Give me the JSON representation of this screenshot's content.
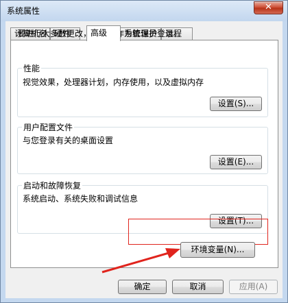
{
  "window": {
    "title": "系统属性",
    "close_label": "✕"
  },
  "tabs": [
    {
      "label": "计算机名",
      "active": false
    },
    {
      "label": "硬件",
      "active": false
    },
    {
      "label": "高级",
      "active": true
    },
    {
      "label": "系统保护",
      "active": false
    },
    {
      "label": "远程",
      "active": false
    }
  ],
  "notice": "要进行大多数更改，您必须作为管理员登录。",
  "groups": {
    "performance": {
      "title": "性能",
      "desc": "视觉效果，处理器计划，内存使用，以及虚拟内存",
      "button": "设置(S)..."
    },
    "profiles": {
      "title": "用户配置文件",
      "desc": "与您登录有关的桌面设置",
      "button": "设置(E)..."
    },
    "startup": {
      "title": "启动和故障恢复",
      "desc": "系统启动、系统失败和调试信息",
      "button": "设置(T)..."
    }
  },
  "env_button": "环境变量(N)...",
  "footer": {
    "ok": "确定",
    "cancel": "取消",
    "apply": "应用(A)"
  },
  "colors": {
    "annotation": "#e0241d"
  },
  "icons": {
    "close": "close-icon",
    "arrow": "arrow-annotation-icon"
  }
}
